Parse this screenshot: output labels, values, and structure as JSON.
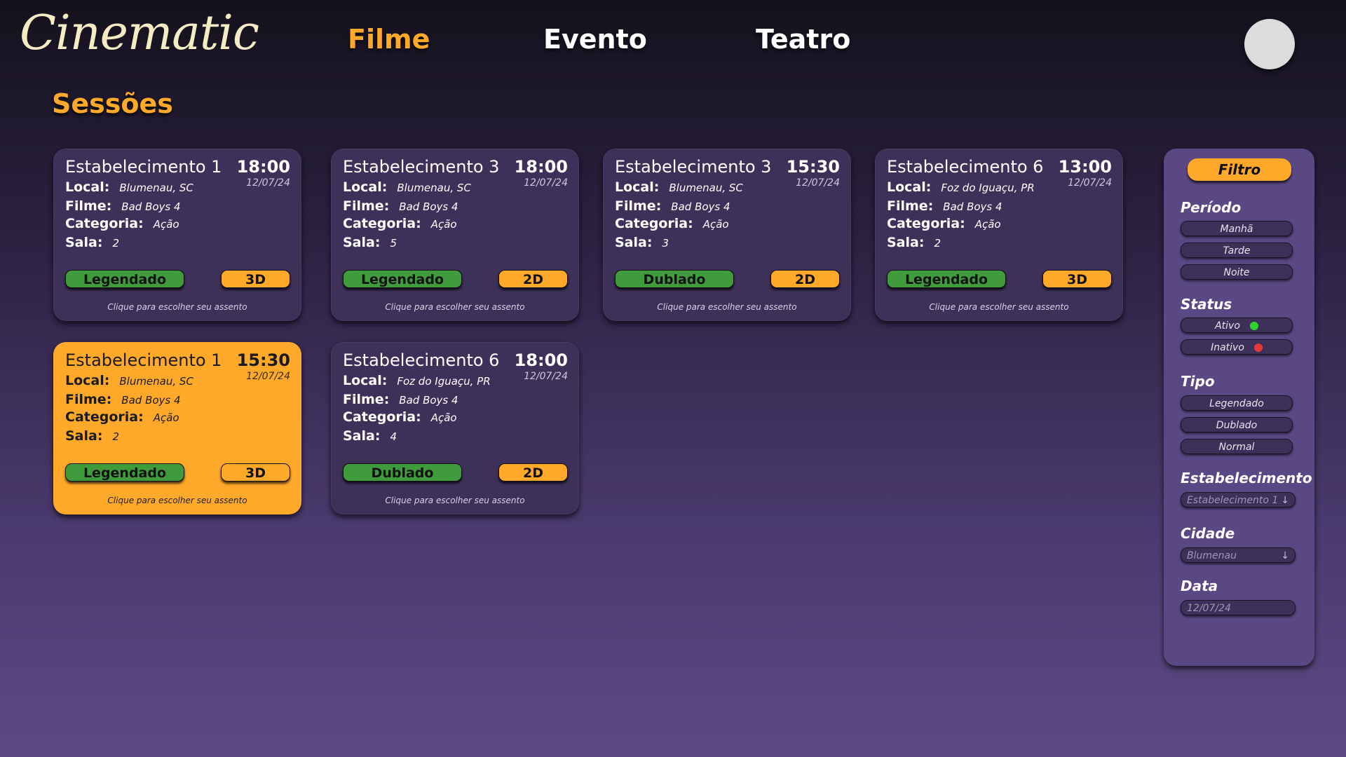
{
  "app": {
    "logo": "Cinematic"
  },
  "nav": {
    "items": [
      "Filme",
      "Evento",
      "Teatro"
    ],
    "active": "Filme"
  },
  "page": {
    "title": "Sessões"
  },
  "labels": {
    "local": "Local:",
    "filme": "Filme:",
    "categoria": "Categoria:",
    "sala": "Sala:"
  },
  "sessions": [
    {
      "name": "Estabelecimento 1",
      "time": "18:00",
      "date": "12/07/24",
      "local": "Blumenau, SC",
      "filme": "Bad Boys 4",
      "categoria": "Ação",
      "sala": "2",
      "lang": "Legendado",
      "format": "3D",
      "hint": "Clique para escolher seu assento",
      "highlighted": false
    },
    {
      "name": "Estabelecimento 3",
      "time": "18:00",
      "date": "12/07/24",
      "local": "Blumenau, SC",
      "filme": "Bad Boys 4",
      "categoria": "Ação",
      "sala": "5",
      "lang": "Legendado",
      "format": "2D",
      "hint": "Clique para escolher seu assento",
      "highlighted": false
    },
    {
      "name": "Estabelecimento 3",
      "time": "15:30",
      "date": "12/07/24",
      "local": "Blumenau, SC",
      "filme": "Bad Boys 4",
      "categoria": "Ação",
      "sala": "3",
      "lang": "Dublado",
      "format": "2D",
      "hint": "Clique para escolher seu assento",
      "highlighted": false
    },
    {
      "name": "Estabelecimento 6",
      "time": "13:00",
      "date": "12/07/24",
      "local": "Foz do Iguaçu, PR",
      "filme": "Bad Boys 4",
      "categoria": "Ação",
      "sala": "2",
      "lang": "Legendado",
      "format": "3D",
      "hint": "Clique para escolher seu assento",
      "highlighted": false
    },
    {
      "name": "Estabelecimento 1",
      "time": "15:30",
      "date": "12/07/24",
      "local": "Blumenau, SC",
      "filme": "Bad Boys 4",
      "categoria": "Ação",
      "sala": "2",
      "lang": "Legendado",
      "format": "3D",
      "hint": "Clique para escolher seu assento",
      "highlighted": true
    },
    {
      "name": "Estabelecimento 6",
      "time": "18:00",
      "date": "12/07/24",
      "local": "Foz do Iguaçu, PR",
      "filme": "Bad Boys 4",
      "categoria": "Ação",
      "sala": "4",
      "lang": "Dublado",
      "format": "2D",
      "hint": "Clique para escolher seu assento",
      "highlighted": false
    }
  ],
  "filter": {
    "title": "Filtro",
    "periodo": {
      "label": "Período",
      "options": [
        "Manhã",
        "Tarde",
        "Noite"
      ]
    },
    "status": {
      "label": "Status",
      "options": [
        "Ativo",
        "Inativo"
      ]
    },
    "tipo": {
      "label": "Tipo",
      "options": [
        "Legendado",
        "Dublado",
        "Normal"
      ]
    },
    "estabelecimento": {
      "label": "Estabelecimento",
      "value": "Estabelecimento 1"
    },
    "cidade": {
      "label": "Cidade",
      "value": "Blumenau"
    },
    "data": {
      "label": "Data",
      "value": "12/07/24"
    }
  },
  "colors": {
    "accent": "#ffa92b",
    "green": "#3f9b3c",
    "card": "#3e3159",
    "panel": "#5a4884"
  },
  "icons": {
    "dropdown": "arrow-down-icon",
    "status_active": "green-dot-icon",
    "status_inactive": "red-dot-icon"
  }
}
